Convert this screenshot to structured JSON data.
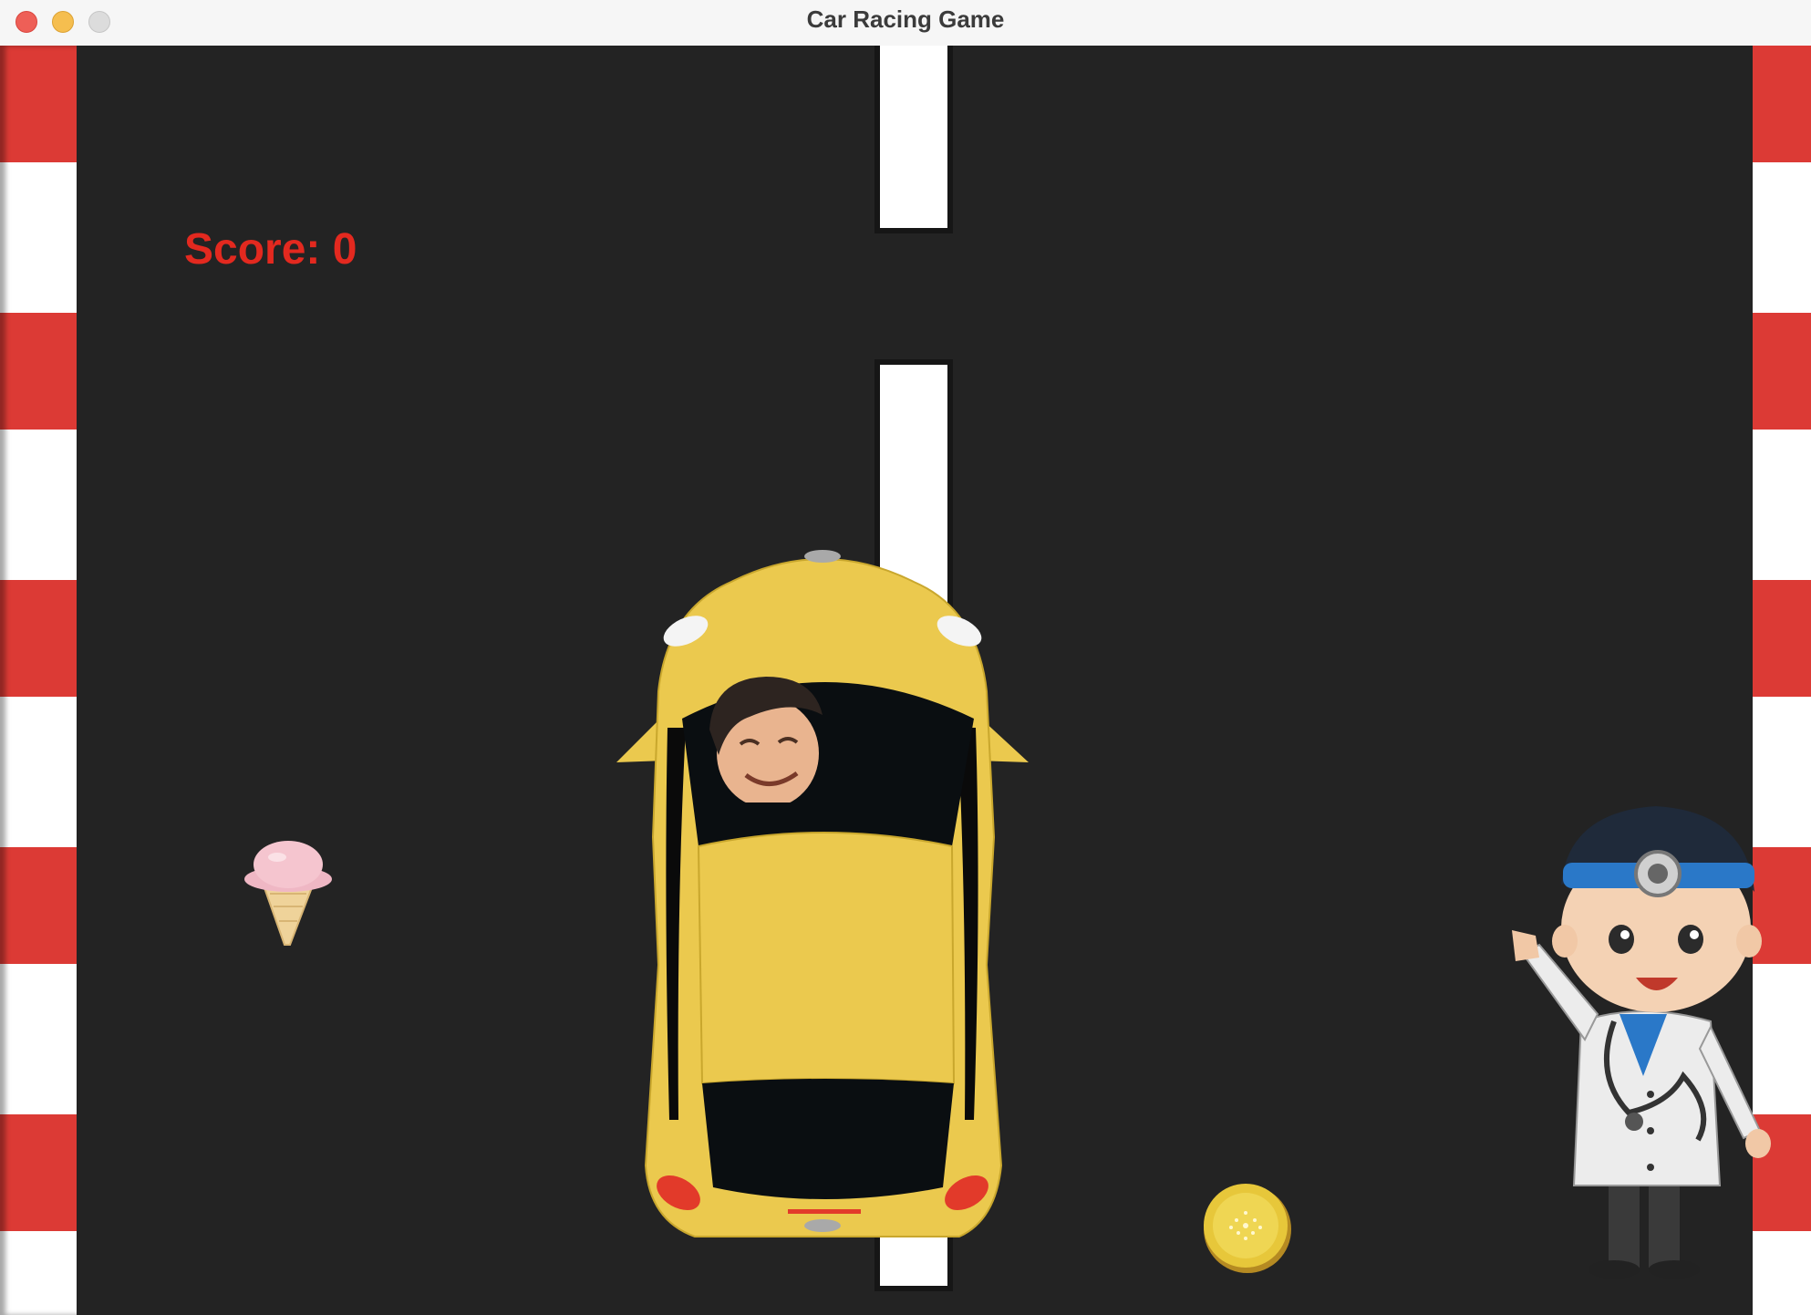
{
  "window": {
    "title": "Car Racing Game"
  },
  "hud": {
    "score_label": "Score: 0",
    "score": 0
  },
  "sprites": {
    "player_car": "yellow-car-icon",
    "driver": "driver-face-icon",
    "ice_cream": "ice-cream-icon",
    "burger": "burger-icon",
    "doctor": "doctor-icon"
  },
  "colors": {
    "road": "#232323",
    "kerb_red": "#dc3a35",
    "kerb_white": "#ffffff",
    "score_text": "#e3291f",
    "car_body": "#ebc94e"
  }
}
